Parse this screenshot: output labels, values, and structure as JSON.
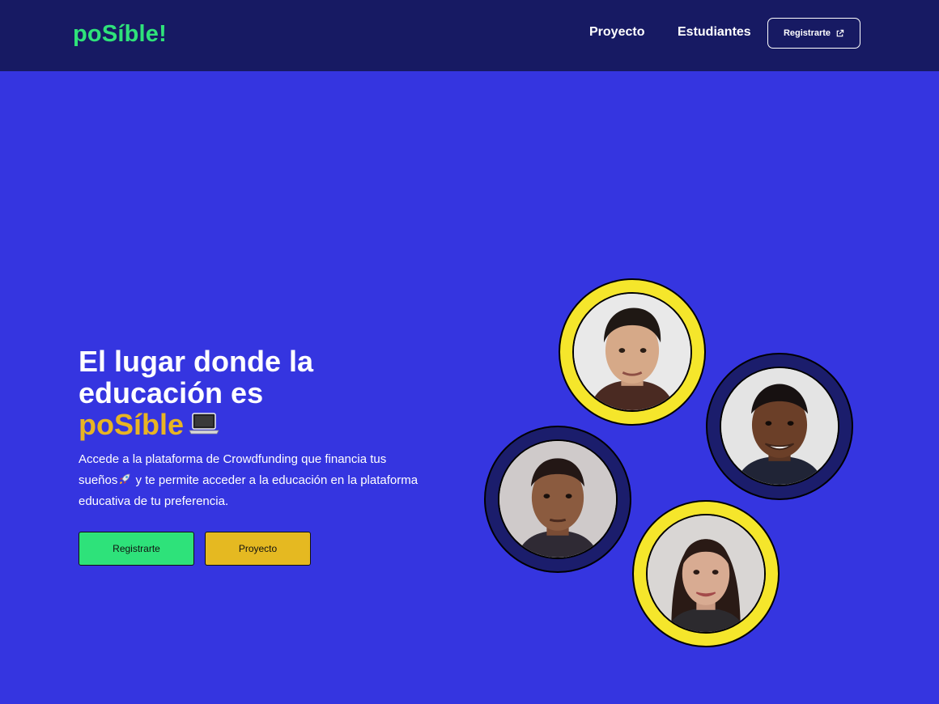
{
  "navbar": {
    "logo": "poSíble!",
    "links": [
      {
        "label": "Proyecto"
      },
      {
        "label": "Estudiantes"
      }
    ],
    "register_label": "Registrarte",
    "register_icon": "external-link-icon"
  },
  "hero": {
    "title_line1": "El lugar donde la",
    "title_line2": "educación es",
    "title_brand": "poSíble",
    "title_icon": "laptop-icon",
    "description_part1": "Accede a la plataforma de Crowdfunding que financia tus sueños",
    "description_icon": "rocket-icon",
    "description_part2": " y te permite acceder a la educación en la plataforma educativa de tu preferencia.",
    "buttons": {
      "register": "Registrarte",
      "project": "Proyecto"
    }
  },
  "avatars": [
    {
      "name": "student-1",
      "ring": "yellow"
    },
    {
      "name": "student-2",
      "ring": "navy"
    },
    {
      "name": "student-3",
      "ring": "navy"
    },
    {
      "name": "student-4",
      "ring": "yellow"
    }
  ],
  "colors": {
    "background": "#3535e0",
    "navbar": "#171a63",
    "logo": "#2fe27a",
    "brand_accent": "#e8b423",
    "register_button": "#2ee27a",
    "project_button": "#e5b921",
    "ring_yellow": "#f5e62b",
    "ring_navy": "#1b1d6c"
  }
}
